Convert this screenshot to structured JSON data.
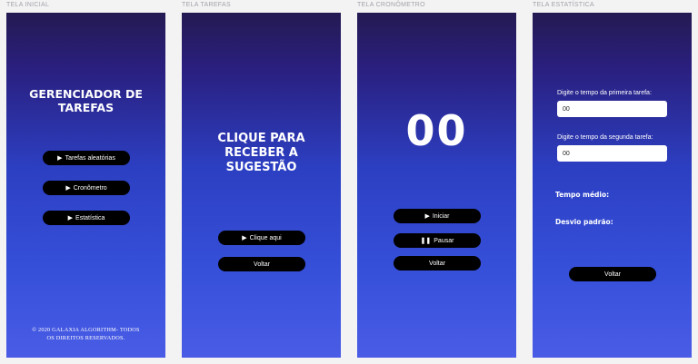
{
  "frames": {
    "inicial_label": "TELA INICIAL",
    "tarefas_label": "TELA TAREFAS",
    "cronometro_label": "TELA CRONÔMETRO",
    "estatistica_label": "TELA ESTATÍSTICA"
  },
  "inicial": {
    "title_line1": "GERENCIADOR DE",
    "title_line2": "TAREFAS",
    "btn_tarefas": "Tarefas aleatórias",
    "btn_cronometro": "Cronômetro",
    "btn_estatistica": "Estatística",
    "footer_line1": "© 2020 GALAXIA ALGORITHM- TODOS",
    "footer_line2": "OS DIREITOS RESERVADOS."
  },
  "tarefas": {
    "title_line1": "CLIQUE PARA",
    "title_line2": "RECEBER A",
    "title_line3": "SUGESTÃO",
    "btn_clique": "Clique aqui",
    "btn_voltar": "Voltar"
  },
  "cronometro": {
    "display": "00",
    "btn_iniciar": "Iniciar",
    "btn_pausar": "Pausar",
    "btn_voltar": "Voltar"
  },
  "estatistica": {
    "label_primeira": "Digite o tempo da primeira tarefa:",
    "value_primeira": "00",
    "label_segunda": "Digite o tempo da segunda tarefa:",
    "value_segunda": "00",
    "tempo_medio": "Tempo médio:",
    "desvio_padrao": "Desvio padrão:",
    "btn_voltar": "Voltar"
  },
  "icons": {
    "play": "play-icon",
    "pause": "pause-icon"
  }
}
